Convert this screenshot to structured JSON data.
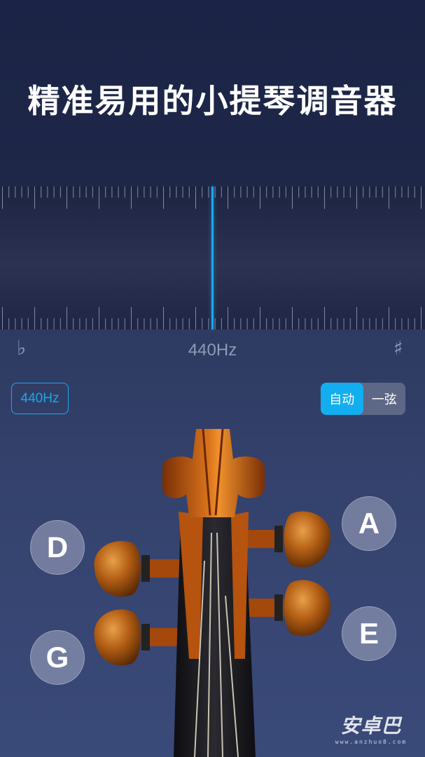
{
  "header": {
    "title": "精准易用的小提琴调音器"
  },
  "meter": {
    "flat_symbol": "♭",
    "sharp_symbol": "♯",
    "frequency_readout": "440Hz",
    "accent_color": "#1ea7e8"
  },
  "controls": {
    "reference_pitch_label": "440Hz",
    "mode_options": [
      "自动",
      "一弦"
    ],
    "active_mode": "自动"
  },
  "strings": {
    "d": "D",
    "g": "G",
    "a": "A",
    "e": "E"
  },
  "watermark": {
    "logo_text": "安卓巴",
    "url_text": "www.anzhuo8.com"
  }
}
